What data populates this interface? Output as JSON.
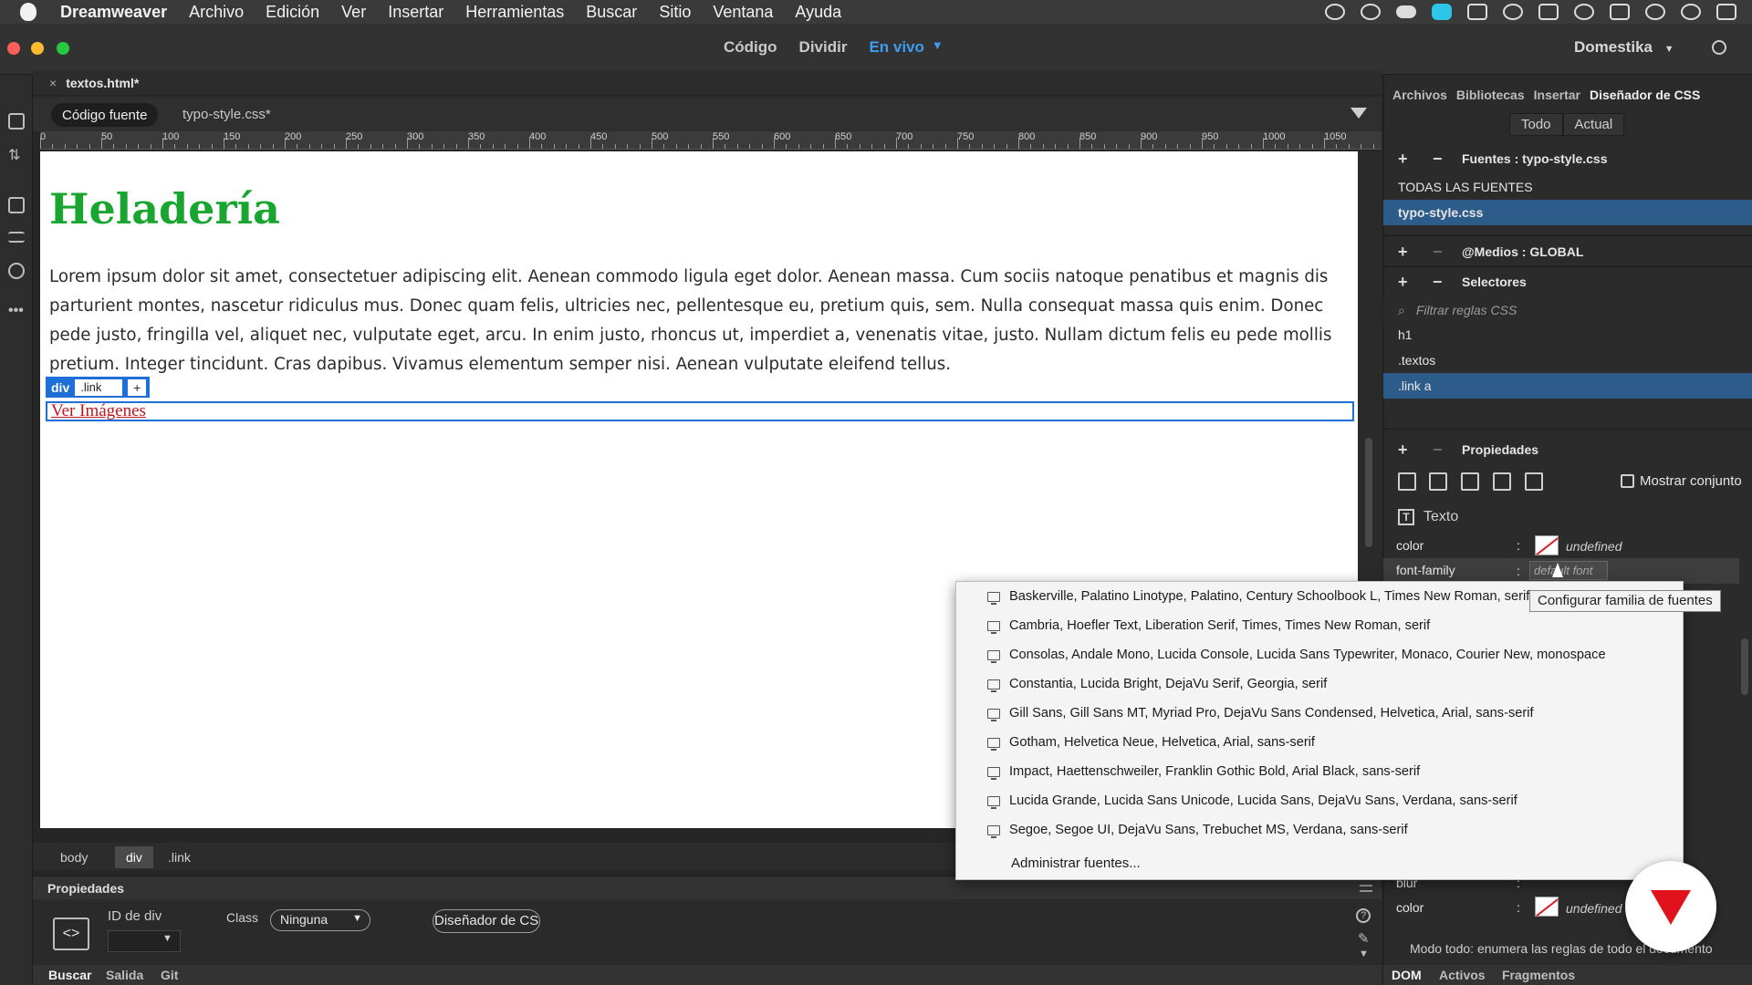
{
  "menubar": {
    "app": "Dreamweaver",
    "items": [
      "Archivo",
      "Edición",
      "Ver",
      "Insertar",
      "Herramientas",
      "Buscar",
      "Sitio",
      "Ventana",
      "Ayuda"
    ]
  },
  "titlebar": {
    "views": [
      "Código",
      "Dividir",
      "En vivo"
    ],
    "active_view": "En vivo",
    "workspace": "Domestika"
  },
  "document": {
    "tab": "textos.html*",
    "source_button": "Código fuente",
    "related_file": "typo-style.css*",
    "ruler_labels": [
      "0",
      "50",
      "100",
      "150",
      "200",
      "250",
      "300",
      "350",
      "400",
      "450",
      "500",
      "550",
      "600",
      "650",
      "700",
      "750",
      "800",
      "850",
      "900",
      "950",
      "1000",
      "1050"
    ]
  },
  "canvas": {
    "heading": "Heladería",
    "paragraph": "Lorem ipsum dolor sit amet, consectetuer adipiscing elit. Aenean commodo ligula eget dolor. Aenean massa. Cum sociis natoque penatibus et magnis dis parturient montes, nascetur ridiculus mus. Donec quam felis, ultricies nec, pellentesque eu, pretium quis, sem. Nulla consequat massa quis enim. Donec pede justo, fringilla vel, aliquet nec, vulputate eget, arcu. In enim justo, rhoncus ut, imperdiet a, venenatis vitae, justo. Nullam dictum felis eu pede mollis pretium. Integer tincidunt. Cras dapibus. Vivamus elementum semper nisi. Aenean vulputate eleifend tellus.",
    "sel_tag": "div",
    "sel_class": ".link",
    "sel_plus": "+",
    "link": "Ver Imágenes"
  },
  "tag_selector": [
    "body",
    "div",
    ".link"
  ],
  "properties": {
    "title": "Propiedades",
    "div_id_label": "ID de div",
    "class_label": "Class",
    "class_value": "Ninguna",
    "css_designer_button": "Diseñador de CS"
  },
  "bottom_tabs": [
    "Buscar",
    "Salida",
    "Git"
  ],
  "right_panel": {
    "tabs": [
      "Archivos",
      "Bibliotecas",
      "Insertar",
      "Diseñador de CSS"
    ],
    "toggle": [
      "Todo",
      "Actual"
    ],
    "sources_title": "Fuentes : typo-style.css",
    "sources": [
      "TODAS LAS FUENTES",
      "typo-style.css"
    ],
    "media_title": "@Medios : GLOBAL",
    "selectors_title": "Selectores",
    "filter_placeholder": "Filtrar reglas CSS",
    "selectors": [
      "h1",
      ".textos",
      ".link a"
    ],
    "properties_title": "Propiedades",
    "show_set": "Mostrar conjunto",
    "text_section": "Texto",
    "color_label": "color",
    "color_value": "undefined",
    "font_family_label": "font-family",
    "font_family_value": "default font",
    "blur_label": "blur",
    "color2_label": "color",
    "color2_value": "undefined",
    "mode_text": "Modo todo: enumera las reglas de todo el documento",
    "bottom_tabs": [
      "DOM",
      "Activos",
      "Fragmentos"
    ]
  },
  "font_dropdown": {
    "items": [
      "Baskerville, Palatino Linotype, Palatino, Century Schoolbook L, Times New Roman, serif",
      "Cambria, Hoefler Text, Liberation Serif, Times, Times New Roman, serif",
      "Consolas, Andale Mono, Lucida Console, Lucida Sans Typewriter, Monaco, Courier New, monospace",
      "Constantia, Lucida Bright, DejaVu Serif, Georgia, serif",
      "Gill Sans, Gill Sans MT, Myriad Pro, DejaVu Sans Condensed, Helvetica, Arial, sans-serif",
      "Gotham, Helvetica Neue, Helvetica, Arial, sans-serif",
      "Impact, Haettenschweiler, Franklin Gothic Bold, Arial Black, sans-serif",
      "Lucida Grande, Lucida Sans Unicode, Lucida Sans, DejaVu Sans, Verdana, sans-serif",
      "Segoe, Segoe UI, DejaVu Sans, Trebuchet MS, Verdana, sans-serif"
    ],
    "manage": "Administrar fuentes..."
  },
  "tooltip": "Configurar familia de fuentes",
  "icons": {
    "apple": "apple-icon",
    "filter": "filter-icon",
    "monitor": "monitor-icon",
    "logo": "domestika-logo-icon"
  }
}
